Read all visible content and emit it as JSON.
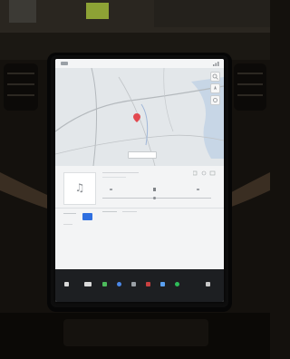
{
  "scene": {
    "background_color": "#14110d",
    "screen_color": "#eef0f2",
    "dock_color": "#1d1f22",
    "accent": "#2f6fe0"
  },
  "status_bar": {
    "left_text": "",
    "right_text": ""
  },
  "map": {
    "pin_color": "#e2484f",
    "icons": [
      "search-icon",
      "compass-icon",
      "settings-icon"
    ]
  },
  "media": {
    "album_art_icon": "music-note-icon",
    "album_art_glyph": "♫",
    "source_tabs": [
      "",
      ""
    ]
  },
  "dock": {
    "icons": [
      "car-icon",
      "phone-icon",
      "camera-icon",
      "apps-icon",
      "music-icon",
      "calendar-icon",
      "spotify-icon",
      "volume-icon"
    ],
    "icon_colors": [
      "#d9d9d9",
      "#4dbb5c",
      "#4b88e8",
      "#9aa0a6",
      "#c84040",
      "#5aa0f0",
      "#2ebd59",
      "#c9c9c9"
    ]
  }
}
